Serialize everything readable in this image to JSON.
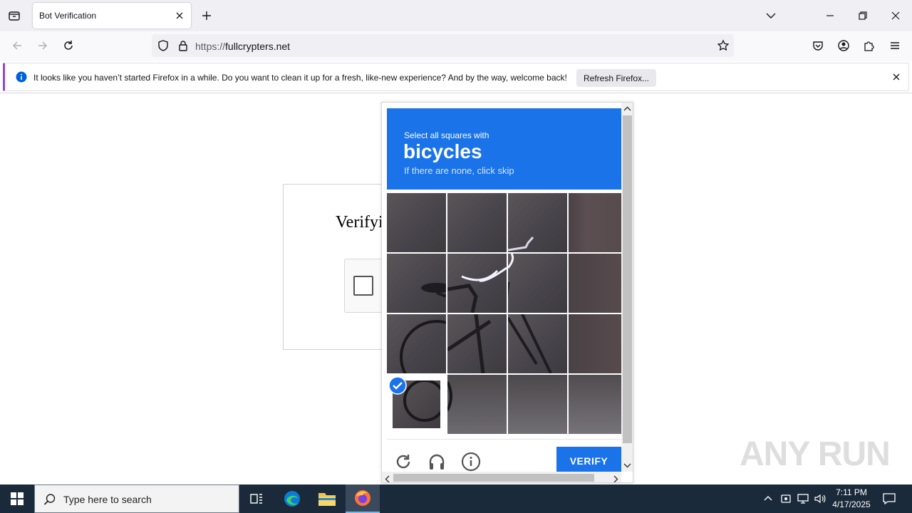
{
  "browser": {
    "tab_title": "Bot Verification",
    "url_prefix": "https://",
    "url_domain": "fullcrypters.net"
  },
  "notification": {
    "message": "It looks like you haven’t started Firefox in a while. Do you want to clean it up for a fresh, like-new experience? And by the way, welcome back!",
    "button_label": "Refresh Firefox..."
  },
  "page": {
    "verify_title": "Verifyi"
  },
  "captcha": {
    "instruction": "Select all squares with",
    "object": "bicycles",
    "hint": "If there are none, click skip",
    "verify_label": "VERIFY",
    "header_color": "#1a73e8",
    "selected_tiles": [
      12
    ],
    "grid": "4x4"
  },
  "taskbar": {
    "search_placeholder": "Type here to search",
    "time": "7:11 PM",
    "date": "4/17/2025"
  },
  "watermark": "ANY RUN"
}
